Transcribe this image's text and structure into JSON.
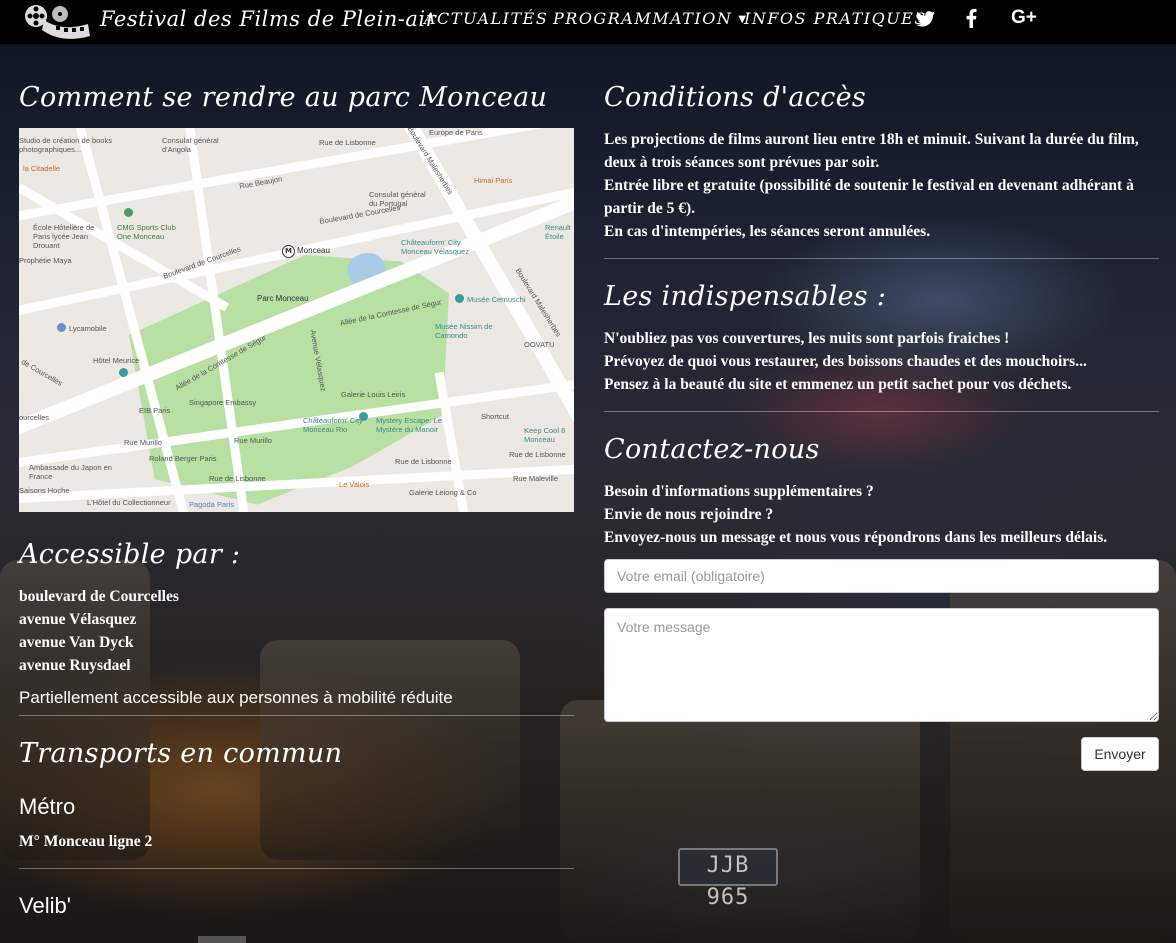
{
  "nav": {
    "brand": "Festival des Films de Plein-air",
    "links": [
      "ACTUALITÉS",
      "PROGRAMMATION",
      "INFOS PRATIQUES"
    ],
    "social_icons": [
      "twitter-icon",
      "facebook-icon",
      "google-plus-icon"
    ]
  },
  "access": {
    "title": "Comment se rendre au parc Monceau",
    "map_labels": {
      "park": "Parc Monceau",
      "metro": "Monceau",
      "boulevard": "Boulevard de Courcelles",
      "boulevard2": "Boulevard de Courcelles",
      "malesherbes": "Boulevard Malesherbes",
      "malesherbes2": "Boulevard Malesherbes",
      "cernuschi": "Musée Cernuschi",
      "nissim": "Musée Nissim de Camondo",
      "chateauform": "Châteauform' City Monceau Vélasquez",
      "singapore": "Singapore Embassy",
      "galerie": "Galerie Louis Leiris",
      "mystery": "Mystery Escape: Le Mystère du Manoir",
      "chateauform2": "Châteauform' City Monceau Rio",
      "roland": "Roland Berger Paris",
      "lyc": "Lycamobile",
      "meurice": "Hôtel Meurice",
      "elb": "EIB Paris",
      "cmg": "CMG Sports Club One Monceau",
      "ecole": "École Hôtelière de Paris lycée Jean Drouant",
      "consulat": "Consulat général d'Angola",
      "consulat2": "Consulat général du Portugal",
      "himai": "Himai Paris",
      "renault": "Renault Étoile",
      "citadelle": "la Citadelle",
      "ambassade": "Ambassade du Japon en France",
      "saisons": "Saisons Hoche",
      "pagoda": "Pagoda Paris",
      "valois": "Le Valois",
      "leiong": "Galerie Leiong & Co",
      "keepcool": "Keep Cool 8 Monceau",
      "ovavu": "OOVATU",
      "shortcut": "Shortcut",
      "collectionneur": "L'Hôtel du Collectionneur",
      "europe": "Europe de Paris",
      "rue_lisbonne": "Rue de Lisbonne",
      "rue_lisbonne2": "Rue de Lisbonne",
      "rue_lisbonne3": "Rue de Lisbonne",
      "rue_murillo": "Rue Murillo",
      "rue_murillo2": "Rue Murillo",
      "velasquez": "Avenue Vélasquez",
      "segur": "Allée de la Comtesse de Ségur",
      "segur2": "Allée de la Comtesse de Ségur",
      "courcelles": "de Courcelles",
      "courcelles2": "ourcelles",
      "studio": "Studio de création de books photographiques...",
      "prophetie": "Prophétie Maya",
      "ruebeaujon": "Rue Beaujon",
      "ruemaleville": "Rue Maleville",
      "ruedelisle": "Rue de Lisbonne"
    },
    "accessible_title": "Accessible par :",
    "streets": [
      "boulevard de Courcelles",
      "avenue Vélasquez",
      "avenue Van Dyck",
      "avenue Ruysdael"
    ],
    "pmr": "Partiellement accessible aux personnes à mobilité réduite",
    "transport_title": "Transports en commun",
    "metro_title": "Métro",
    "metro_line": "M° Monceau ligne 2",
    "velib_title": "Velib'"
  },
  "conditions": {
    "title": "Conditions d'accès",
    "lines": [
      "Les projections de films auront lieu entre 18h et minuit. Suivant la durée du film,",
      "deux à trois séances sont prévues par soir.",
      "Entrée libre et gratuite (possibilité de soutenir le festival en devenant adhérant à",
      "partir de 5 €).",
      "En cas d'intempéries, les séances seront annulées."
    ]
  },
  "essentials": {
    "title": "Les indispensables :",
    "lines": [
      "N'oubliez pas vos couvertures, les nuits sont parfois fraiches !",
      "Prévoyez de quoi vous restaurer, des boissons chaudes et des mouchoirs...",
      "Pensez à la beauté du site et emmenez un petit sachet pour vos déchets."
    ]
  },
  "contact": {
    "title": "Contactez-nous",
    "lines": [
      "Besoin d'informations supplémentaires ?",
      "Envie de nous rejoindre ?",
      "Envoyez-nous un message et nous vous répondrons dans les meilleurs délais."
    ],
    "email_placeholder": "Votre email (obligatoire)",
    "message_placeholder": "Votre message",
    "submit_label": "Envoyer"
  },
  "background": {
    "plate": "JJB 965"
  }
}
